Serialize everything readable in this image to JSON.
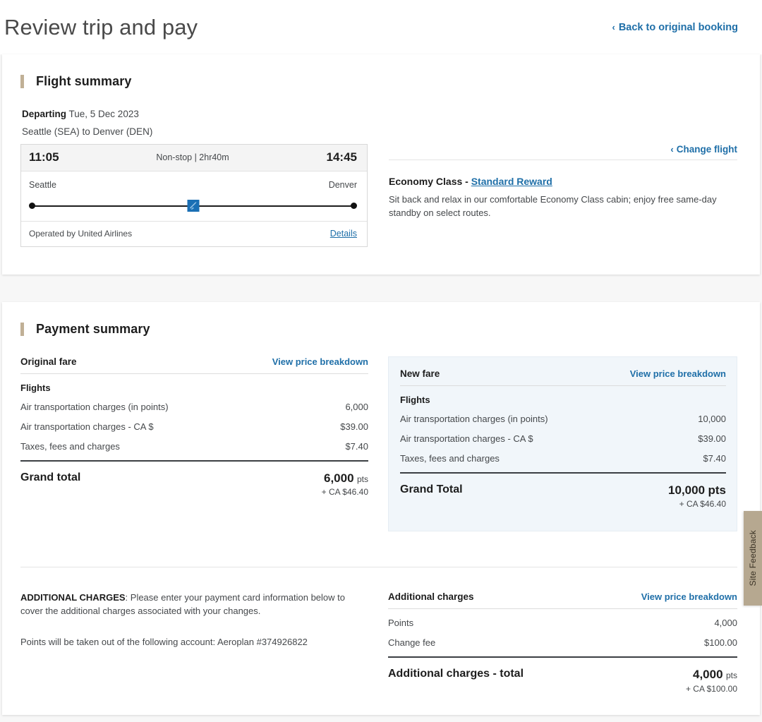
{
  "header": {
    "title": "Review trip and pay",
    "back_link": "Back to original booking",
    "back_chevron": "chevron-left-icon"
  },
  "flight_summary": {
    "section_title": "Flight summary",
    "departing_label": "Departing",
    "departing_date": "Tue, 5 Dec 2023",
    "route": "Seattle (SEA) to Denver (DEN)",
    "change_flight_label": "Change flight",
    "itinerary": {
      "depart_time": "11:05",
      "arrive_time": "14:45",
      "stops_duration": "Non-stop | 2hr40m",
      "origin_city": "Seattle",
      "destination_city": "Denver",
      "operated_by": "Operated by United Airlines",
      "details_link": "Details"
    },
    "cabin": {
      "class_label": "Economy Class - ",
      "fare_brand": "Standard Reward",
      "description": "Sit back and relax in our comfortable Economy Class cabin; enjoy free same-day standby on select routes."
    }
  },
  "payment_summary": {
    "section_title": "Payment summary",
    "view_price_breakdown": "View price breakdown",
    "original_fare": {
      "title": "Original fare",
      "group_label": "Flights",
      "items": [
        {
          "label": "Air transportation charges (in points)",
          "value": "6,000"
        },
        {
          "label": "Air transportation charges - CA $",
          "value": "$39.00"
        },
        {
          "label": "Taxes, fees and charges",
          "value": "$7.40"
        }
      ],
      "total_label": "Grand total",
      "total_points": "6,000",
      "total_points_unit": "pts",
      "total_cash": "+ CA $46.40"
    },
    "new_fare": {
      "title": "New fare",
      "group_label": "Flights",
      "items": [
        {
          "label": "Air transportation charges (in points)",
          "value": "10,000"
        },
        {
          "label": "Air transportation charges - CA $",
          "value": "$39.00"
        },
        {
          "label": "Taxes, fees and charges",
          "value": "$7.40"
        }
      ],
      "total_label": "Grand Total",
      "total_points": "10,000",
      "total_points_unit": "pts",
      "total_cash": "+ CA $46.40"
    },
    "additional_note_bold": "ADDITIONAL CHARGES",
    "additional_note_rest": ": Please enter your payment card information below to cover the additional charges associated with your changes.",
    "account_note": "Points will be taken out of the following account: Aeroplan #374926822",
    "additional_charges": {
      "title": "Additional charges",
      "items": [
        {
          "label": "Points",
          "value": "4,000"
        },
        {
          "label": "Change fee",
          "value": "$100.00"
        }
      ],
      "total_label": "Additional charges - total",
      "total_points": "4,000",
      "total_points_unit": "pts",
      "total_cash": "+ CA $100.00"
    }
  },
  "site_feedback": {
    "label": "Site Feedback"
  },
  "colors": {
    "link_blue": "#1f6fa8",
    "accent_tan": "#c0b096",
    "highlight_bg": "#f1f6fa",
    "feedback_tab": "#b6a890",
    "plane_icon": "#1a6fb4"
  }
}
